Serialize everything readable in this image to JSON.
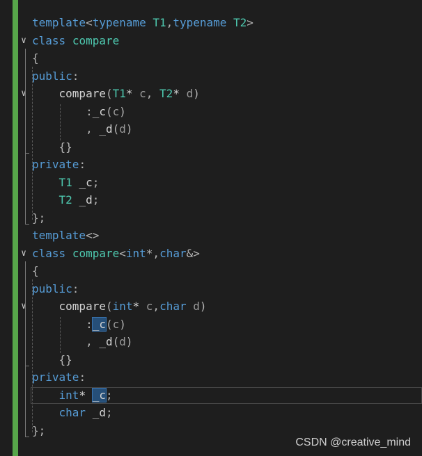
{
  "editor": {
    "fold_glyph": "∨",
    "lines": {
      "l1": [
        "template",
        "<",
        "typename",
        " ",
        "T1",
        ",",
        "typename",
        " ",
        "T2",
        ">"
      ],
      "l2": [
        "class",
        " ",
        "compare"
      ],
      "l3": [
        "{"
      ],
      "l4": [
        "public",
        ":"
      ],
      "l5": [
        "    ",
        "compare",
        "(",
        "T1",
        "* ",
        "c",
        ", ",
        "T2",
        "* ",
        "d",
        ")"
      ],
      "l6": [
        "        ",
        ":",
        "_c",
        "(",
        "c",
        ")"
      ],
      "l7": [
        "        ",
        ", ",
        "_d",
        "(",
        "d",
        ")"
      ],
      "l8": [
        "    ",
        "{}"
      ],
      "l9": [
        "private",
        ":"
      ],
      "l10": [
        "    ",
        "T1",
        " ",
        "_c",
        ";"
      ],
      "l11": [
        "    ",
        "T2",
        " ",
        "_d",
        ";"
      ],
      "l12": [
        "};"
      ],
      "l13": [
        "template",
        "<>"
      ],
      "l14": [
        "class",
        " ",
        "compare",
        "<",
        "int",
        "*,",
        "char",
        "&>"
      ],
      "l15": [
        "{"
      ],
      "l16": [
        "public",
        ":"
      ],
      "l17": [
        "    ",
        "compare",
        "(",
        "int",
        "* ",
        "c",
        ",",
        "char",
        " ",
        "d",
        ")"
      ],
      "l18": [
        "        ",
        ":",
        "_c",
        "(",
        "c",
        ")"
      ],
      "l19": [
        "        ",
        ", ",
        "_d",
        "(",
        "d",
        ")"
      ],
      "l20": [
        "    ",
        "{}"
      ],
      "l21": [
        "private",
        ":"
      ],
      "l22": [
        "    ",
        "int",
        "* ",
        "_c",
        ";"
      ],
      "l23": [
        "    ",
        "char",
        " ",
        "_d",
        ";"
      ],
      "l24": [
        "};"
      ]
    }
  },
  "colors": {
    "background": "#1e1e1e",
    "keyword": "#569cd6",
    "type": "#4ec9b0",
    "identifier": "#d4d4d4",
    "parameter": "#9a9a9a",
    "punctuation": "#b4b4b4",
    "gutter_change": "#57a64a",
    "reference_highlight": "#264f78"
  },
  "watermark": "CSDN @creative_mind"
}
